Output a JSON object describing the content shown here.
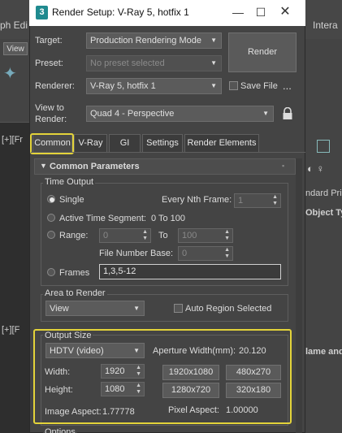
{
  "window": {
    "title": "Render Setup: V-Ray 5, hotfix 1",
    "app_icon": "3"
  },
  "background": {
    "menu_left": "ph Edi",
    "menu_right": "Intera",
    "view_label": "View",
    "viewport_top_label": "[+][Fr",
    "viewport_bottom_label": "[+][F",
    "panel_text_1": "ndard Prim",
    "panel_text_2": "Object Ty",
    "panel_text_3": "lame and"
  },
  "header": {
    "target_label": "Target:",
    "target_value": "Production Rendering Mode",
    "preset_label": "Preset:",
    "preset_placeholder": "No preset selected",
    "renderer_label": "Renderer:",
    "renderer_value": "V-Ray 5, hotfix 1",
    "save_file_label": "Save File",
    "ellipsis_label": "...",
    "view_to_render_label_1": "View to",
    "view_to_render_label_2": "Render:",
    "view_to_render_value": "Quad 4 - Perspective",
    "render_button": "Render"
  },
  "tabs": [
    "Common",
    "V-Ray",
    "GI",
    "Settings",
    "Render Elements"
  ],
  "common_parameters": {
    "rollout_title": "Common Parameters",
    "time_output": {
      "title": "Time Output",
      "single": "Single",
      "every_nth_frame_label": "Every Nth Frame:",
      "every_nth_frame_value": "1",
      "active_time_segment": "Active Time Segment:",
      "active_time_segment_value": "0 To 100",
      "range_label": "Range:",
      "range_start": "0",
      "range_to": "To",
      "range_end": "100",
      "file_number_base_label": "File Number Base:",
      "file_number_base_value": "0",
      "frames_label": "Frames",
      "frames_value": "1,3,5-12"
    },
    "area_to_render": {
      "title": "Area to Render",
      "dropdown_value": "View",
      "auto_region_selected": "Auto Region Selected"
    },
    "output_size": {
      "title": "Output Size",
      "preset_value": "HDTV (video)",
      "aperture_label": "Aperture Width(mm):",
      "aperture_value": "20.120",
      "width_label": "Width:",
      "width_value": "1920",
      "height_label": "Height:",
      "height_value": "1080",
      "preset_buttons": [
        "1920x1080",
        "480x270",
        "1280x720",
        "320x180"
      ],
      "image_aspect_label": "Image Aspect:",
      "image_aspect_value": "1.77778",
      "pixel_aspect_label": "Pixel Aspect:",
      "pixel_aspect_value": "1.00000"
    },
    "options_title": "Options"
  },
  "colors": {
    "highlight": "#e3d33a",
    "dialog_bg": "#444444",
    "logo": "#1f8a8f"
  }
}
